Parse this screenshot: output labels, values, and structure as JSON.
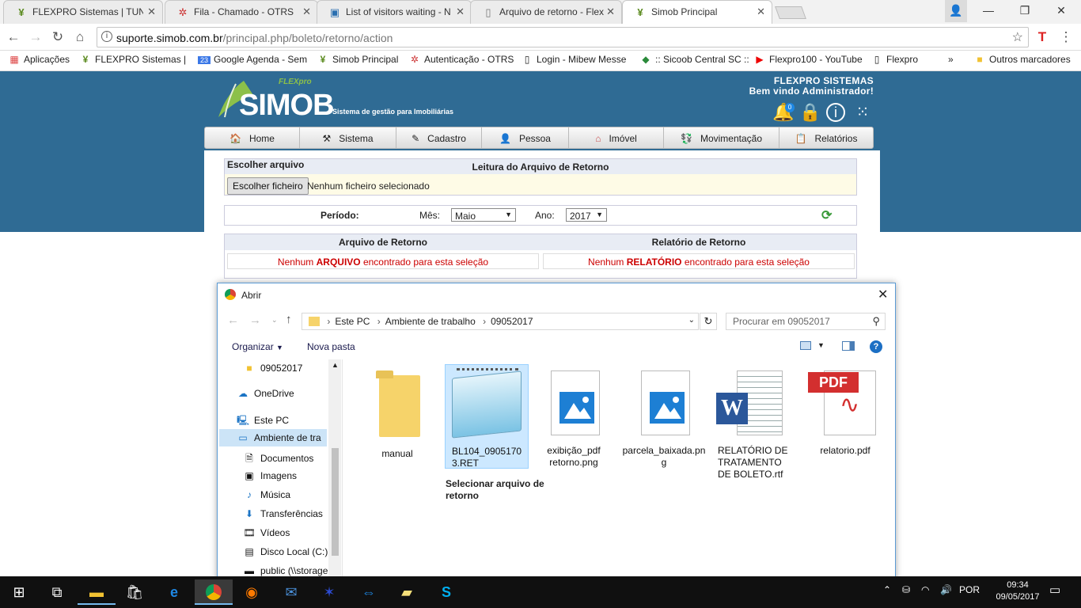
{
  "browser": {
    "tabs": [
      {
        "title": "FLEXPRO Sistemas | TUN",
        "icon": "flexpro-favicon"
      },
      {
        "title": "Fila - Chamado - OTRS",
        "icon": "otrs-favicon"
      },
      {
        "title": "List of visitors waiting - N",
        "icon": "visitors-favicon"
      },
      {
        "title": "Arquivo de retorno - Flex",
        "icon": "page-favicon"
      },
      {
        "title": "Simob Principal",
        "icon": "flexpro-favicon"
      }
    ],
    "url_host": "suporte.simob.com.br",
    "url_path": "/principal.php/boleto/retorno/action",
    "bookmarks": [
      {
        "label": "Aplicações",
        "icon": "apps-icon"
      },
      {
        "label": "FLEXPRO Sistemas | TU",
        "icon": "flexpro-favicon"
      },
      {
        "label": "Google Agenda - Sem",
        "icon": "calendar-icon"
      },
      {
        "label": "Simob Principal",
        "icon": "flexpro-favicon"
      },
      {
        "label": "Autenticação - OTRS",
        "icon": "otrs-favicon"
      },
      {
        "label": "Login - Mibew Messe",
        "icon": "page-favicon"
      },
      {
        "label": ":: Sicoob Central SC ::",
        "icon": "sicoob-favicon"
      },
      {
        "label": "Flexpro100 - YouTube",
        "icon": "youtube-icon"
      },
      {
        "label": "Flexpro",
        "icon": "page-favicon"
      },
      {
        "label": "Outros marcadores",
        "icon": "folder-icon"
      }
    ],
    "calendar_badge": "23"
  },
  "site": {
    "logo_text": "SIMOB",
    "logo_sub": "Sistema de gestão para Imobiliárias",
    "logo_small": "FLEXpro",
    "company": "FLEXPRO SISTEMAS",
    "welcome": "Bem vindo Administrador!",
    "notif_count": "0",
    "menu": [
      {
        "label": "Home",
        "icon": "home-icon"
      },
      {
        "label": "Sistema",
        "icon": "tools-icon"
      },
      {
        "label": "Cadastro",
        "icon": "pen-icon"
      },
      {
        "label": "Pessoa",
        "icon": "person-icon"
      },
      {
        "label": "Imóvel",
        "icon": "house-icon"
      },
      {
        "label": "Movimentação",
        "icon": "money-icon"
      },
      {
        "label": "Relatórios",
        "icon": "clipboard-icon"
      }
    ]
  },
  "form": {
    "choose_label": "Escolher arquivo",
    "panel_title": "Leitura do Arquivo de Retorno",
    "file_button": "Escolher ficheiro",
    "file_status": "Nenhum ficheiro selecionado",
    "periodo_label": "Período:",
    "mes_label": "Mês:",
    "mes_value": "Maio",
    "ano_label": "Ano:",
    "ano_value": "2017",
    "col_arquivo": "Arquivo de Retorno",
    "col_relatorio": "Relatório de Retorno",
    "arquivo_msg_pre": "Nenhum ",
    "arquivo_msg_key": "ARQUIVO",
    "arquivo_msg_post": " encontrado para esta seleção",
    "relatorio_msg_pre": "Nenhum ",
    "relatorio_msg_key": "RELATÓRIO",
    "relatorio_msg_post": " encontrado para esta seleção"
  },
  "dialog": {
    "title": "Abrir",
    "breadcrumb": [
      "Este PC",
      "Ambiente de trabalho",
      "09052017"
    ],
    "search_placeholder": "Procurar em 09052017",
    "organize": "Organizar",
    "new_folder": "Nova pasta",
    "nav_items": [
      {
        "label": "09052017",
        "icon": "folder-icon"
      },
      {
        "label": "OneDrive",
        "icon": "cloud-icon"
      },
      {
        "label": "Este PC",
        "icon": "computer-icon"
      },
      {
        "label": "Ambiente de tra",
        "icon": "desktop-icon"
      },
      {
        "label": "Documentos",
        "icon": "documents-icon"
      },
      {
        "label": "Imagens",
        "icon": "pictures-icon"
      },
      {
        "label": "Música",
        "icon": "music-icon"
      },
      {
        "label": "Transferências",
        "icon": "download-icon"
      },
      {
        "label": "Vídeos",
        "icon": "video-icon"
      },
      {
        "label": "Disco Local (C:)",
        "icon": "drive-icon"
      },
      {
        "label": "public (\\\\storage",
        "icon": "network-drive-icon"
      }
    ],
    "files": [
      {
        "name": "manual",
        "type": "folder"
      },
      {
        "name": "BL104_09051703.RET",
        "type": "notepad",
        "tooltip": "Selecionar arquivo de retorno"
      },
      {
        "name": "exibição_pdf retorno.png",
        "type": "image"
      },
      {
        "name": "parcela_baixada.png",
        "type": "image"
      },
      {
        "name": "RELATÓRIO DE TRATAMENTO DE BOLETO.rtf",
        "type": "word"
      },
      {
        "name": "relatorio.pdf",
        "type": "pdf"
      }
    ]
  },
  "taskbar": {
    "language": "POR",
    "time": "09:34",
    "date": "09/05/2017",
    "apps": [
      "windows-start-icon",
      "task-view-icon",
      "file-explorer-icon",
      "store-icon",
      "edge-icon",
      "chrome-icon",
      "firefox-icon",
      "thunderbird-icon",
      "app-icon",
      "teamviewer-icon",
      "sticky-notes-icon",
      "skype-icon"
    ]
  },
  "colors": {
    "brand_blue": "#2f6b94",
    "error_red": "#cc0000",
    "selection": "#cce8ff"
  }
}
